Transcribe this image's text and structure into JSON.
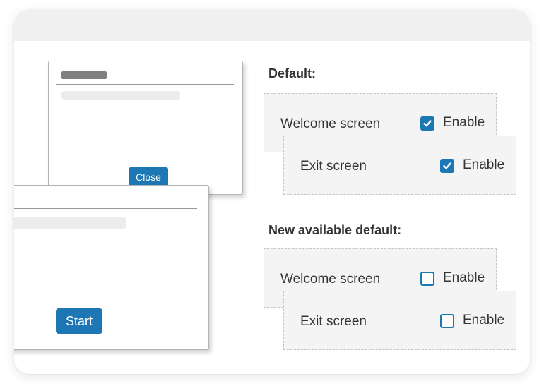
{
  "dialogs": {
    "back": {
      "button_label": "Close"
    },
    "front": {
      "button_label": "Start"
    }
  },
  "sections": [
    {
      "label": "Default:",
      "options": [
        {
          "name": "Welcome screen",
          "toggle_label": "Enable",
          "checked": true
        },
        {
          "name": "Exit screen",
          "toggle_label": "Enable",
          "checked": true
        }
      ]
    },
    {
      "label": "New available default:",
      "options": [
        {
          "name": "Welcome screen",
          "toggle_label": "Enable",
          "checked": false
        },
        {
          "name": "Exit screen",
          "toggle_label": "Enable",
          "checked": false
        }
      ]
    }
  ],
  "colors": {
    "accent": "#1e77b5",
    "option_background": "#f4f4f4",
    "placeholder_dark": "#808080",
    "placeholder_light": "#ececec"
  },
  "icons": {
    "checkmark": "checkmark-icon"
  }
}
